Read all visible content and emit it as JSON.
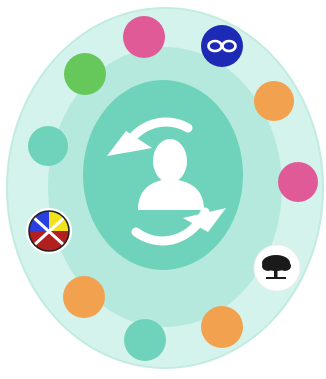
{
  "colors": {
    "page_background": "#ffffff",
    "outer_ring": "#d4f3ec",
    "outer_ring_edge": "#c2ebe2",
    "middle_ring": "#b5e9dd",
    "inner_disc": "#6fd3bb",
    "arrows_and_person": "#ffffff",
    "pink": "#e05a97",
    "green": "#66c75b",
    "blue": "#1c2ab6",
    "orange": "#f2a14f",
    "teal": "#6fd3bb"
  },
  "center": {
    "icon": "account-sync-icon",
    "person_icon": "person-silhouette-icon",
    "arrows_icon": "circular-arrows-icon"
  },
  "satellites": [
    {
      "name": "pink-circle-top",
      "color": "pink",
      "icon": "none"
    },
    {
      "name": "infinity-logo",
      "color": "blue",
      "icon": "infinity-icon"
    },
    {
      "name": "orange-circle-upper-right",
      "color": "orange",
      "icon": "none"
    },
    {
      "name": "pink-circle-right",
      "color": "pink",
      "icon": "none"
    },
    {
      "name": "tree-logo",
      "color": "white",
      "icon": "tree-icon"
    },
    {
      "name": "orange-circle-lower-right",
      "color": "orange",
      "icon": "none"
    },
    {
      "name": "teal-circle-bottom",
      "color": "teal",
      "icon": "none"
    },
    {
      "name": "orange-circle-lower-left",
      "color": "orange",
      "icon": "none"
    },
    {
      "name": "quadrant-logo",
      "color": "multicolor",
      "icon": "four-quadrant-icon"
    },
    {
      "name": "teal-circle-left",
      "color": "teal",
      "icon": "none"
    },
    {
      "name": "green-circle-upper-left",
      "color": "green",
      "icon": "none"
    }
  ]
}
